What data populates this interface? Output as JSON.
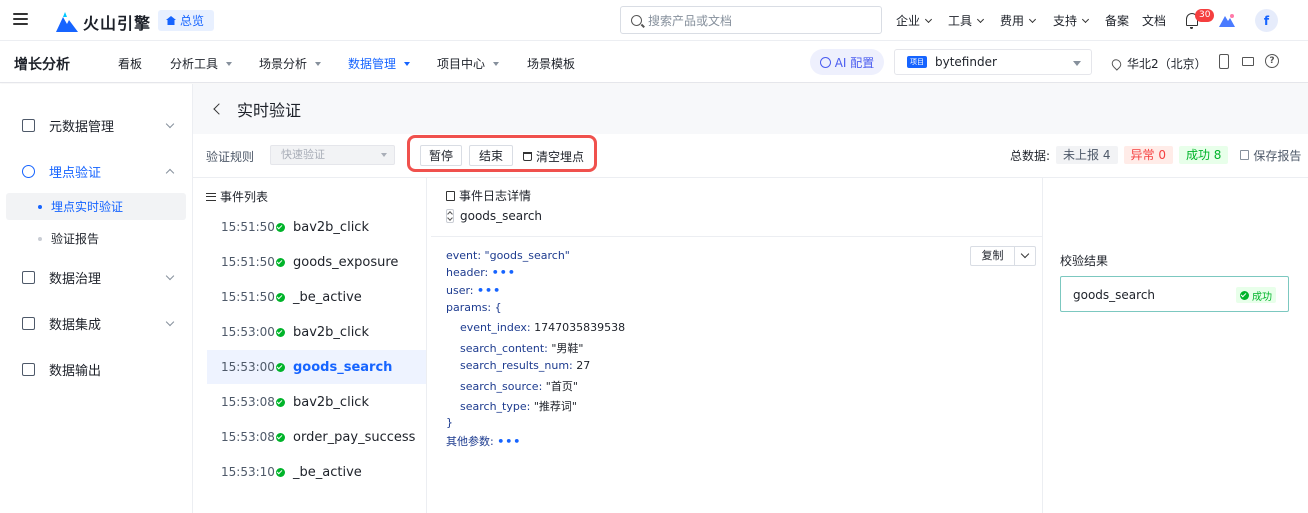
{
  "topbar": {
    "logo_text": "火山引擎",
    "overview_label": "总览",
    "search_placeholder": "搜索产品或文档",
    "menus": [
      "企业",
      "工具",
      "费用",
      "支持"
    ],
    "links": [
      "备案",
      "文档"
    ],
    "notification_count": "30",
    "avatar_letter": "f"
  },
  "subnav": {
    "product_name": "增长分析",
    "items": [
      "看板",
      "分析工具",
      "场景分析",
      "数据管理",
      "项目中心",
      "场景模板"
    ],
    "active_item": "数据管理",
    "ai_label": "AI 配置",
    "project_tag": "项目",
    "project_name": "bytefinder",
    "region": "华北2（北京）"
  },
  "sidebar": {
    "groups": [
      "元数据管理",
      "埋点验证",
      "数据治理",
      "数据集成",
      "数据输出"
    ],
    "sub_items": [
      "埋点实时验证",
      "验证报告"
    ],
    "active_group": "埋点验证",
    "active_sub": "埋点实时验证"
  },
  "page": {
    "title": "实时验证",
    "rule_label": "验证规则",
    "rule_value": "快速验证",
    "buttons": {
      "pause": "暂停",
      "end": "结束",
      "clear": "清空埋点"
    },
    "totals_label": "总数据:",
    "totals": {
      "unreported": "未上报 4",
      "abnormal": "异常 0",
      "success": "成功 8"
    },
    "save_report": "保存报告"
  },
  "event_list": {
    "header": "事件列表",
    "rows": [
      {
        "time": "15:51:50",
        "name": "bav2b_click"
      },
      {
        "time": "15:51:50",
        "name": "goods_exposure"
      },
      {
        "time": "15:51:50",
        "name": "_be_active"
      },
      {
        "time": "15:53:00",
        "name": "bav2b_click"
      },
      {
        "time": "15:53:00",
        "name": "goods_search"
      },
      {
        "time": "15:53:08",
        "name": "bav2b_click"
      },
      {
        "time": "15:53:08",
        "name": "order_pay_success"
      },
      {
        "time": "15:53:10",
        "name": "_be_active"
      }
    ],
    "active_index": 4
  },
  "detail": {
    "title": "事件日志详情",
    "event_name": "goods_search",
    "copy_label": "复制",
    "code": {
      "event_line": "event: \"goods_search\"",
      "header_key": "header:",
      "user_key": "user:",
      "params_open": "params: {",
      "params": [
        {
          "key": "event_index:",
          "value": "1747035839538"
        },
        {
          "key": "search_content:",
          "value": "\"男鞋\""
        },
        {
          "key": "search_results_num:",
          "value": "27"
        },
        {
          "key": "search_source:",
          "value": "\"首页\""
        },
        {
          "key": "search_type:",
          "value": "\"推荐词\""
        }
      ],
      "params_close": "}",
      "other_key": "其他参数:",
      "ellipsis": "•••"
    }
  },
  "result": {
    "title": "校验结果",
    "event_name": "goods_search",
    "status": "成功"
  },
  "colors": {
    "primary": "#1664ff",
    "success": "#00b42a",
    "error": "#f53f3f",
    "highlight_box": "#f0514d"
  }
}
